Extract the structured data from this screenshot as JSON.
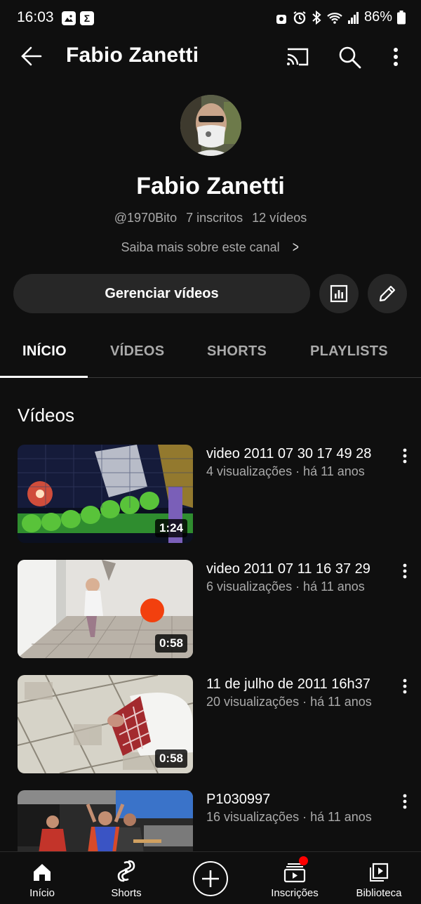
{
  "status_bar": {
    "time": "16:03",
    "battery": "86%"
  },
  "app_bar": {
    "title": "Fabio Zanetti"
  },
  "channel": {
    "name": "Fabio Zanetti",
    "handle": "@1970Bito",
    "subscribers": "7 inscritos",
    "videos_count": "12 vídeos",
    "about_label": "Saiba mais sobre este canal",
    "manage_label": "Gerenciar vídeos"
  },
  "tabs": [
    {
      "label": "INÍCIO",
      "active": true
    },
    {
      "label": "VÍDEOS",
      "active": false
    },
    {
      "label": "SHORTS",
      "active": false
    },
    {
      "label": "PLAYLISTS",
      "active": false
    }
  ],
  "section_title": "Vídeos",
  "videos": [
    {
      "title": "video 2011 07 30 17 49 28",
      "meta": "4 visualizações · há 11 anos",
      "duration": "1:24"
    },
    {
      "title": "video 2011 07 11 16 37 29",
      "meta": "6 visualizações · há 11 anos",
      "duration": "0:58"
    },
    {
      "title": "11 de julho de 2011 16h37",
      "meta": "20 visualizações · há 11 anos",
      "duration": "0:58"
    },
    {
      "title": "P1030997",
      "meta": "16 visualizações · há 11 anos",
      "duration": ""
    }
  ],
  "bottom_nav": [
    {
      "label": "Início",
      "icon": "home-icon"
    },
    {
      "label": "Shorts",
      "icon": "shorts-icon"
    },
    {
      "label": "",
      "icon": "create-icon"
    },
    {
      "label": "Inscrições",
      "icon": "subscriptions-icon"
    },
    {
      "label": "Biblioteca",
      "icon": "library-icon"
    }
  ],
  "colors": {
    "background": "#0f0f0f",
    "surface": "#272727",
    "secondary_text": "#aaaaaa",
    "badge": "#ff0000"
  }
}
